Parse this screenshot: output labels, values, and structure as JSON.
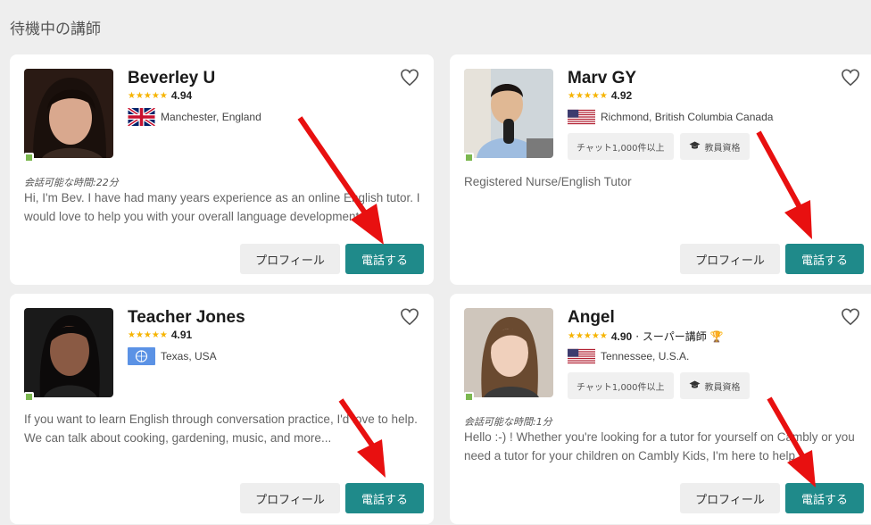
{
  "section_title": "待機中の講師",
  "profile_label": "プロフィール",
  "call_label": "電話する",
  "colors": {
    "accent": "#1f8a8a",
    "star": "#f6b400",
    "online": "#7cb850",
    "arrow": "#e81010"
  },
  "tutors": [
    {
      "name": "Beverley U",
      "stars": "★★★★★",
      "rating": "4.94",
      "location": "Manchester, England",
      "flag": "uk-flag-icon",
      "availability": "会話可能な時間:22分",
      "description": "Hi, I'm Bev. I have had many years experience as an online English tutor. I would love to help you with your overall language development."
    },
    {
      "name": "Marv GY",
      "stars": "★★★★★",
      "rating": "4.92",
      "location": "Richmond, British Columbia Canada",
      "flag": "us-flag-icon",
      "badge_chat": "チャット1,000件以上",
      "badge_teacher": "教員資格",
      "description": "Registered Nurse/English Tutor"
    },
    {
      "name": "Teacher Jones",
      "stars": "★★★★★",
      "rating": "4.91",
      "location": "Texas, USA",
      "flag": "un-flag-icon",
      "description": "If you want to learn English through conversation practice, I'd love to help. We can talk about cooking, gardening, music, and more..."
    },
    {
      "name": "Angel",
      "stars": "★★★★★",
      "rating": "4.90",
      "rating_extra": "· スーパー講師 🏆",
      "location": "Tennessee, U.S.A.",
      "flag": "us-flag-icon",
      "badge_chat": "チャット1,000件以上",
      "badge_teacher": "教員資格",
      "availability": "会話可能な時間:1分",
      "description": "Hello :-) ! Whether you're looking for a tutor for yourself on Cambly or you need a tutor for your children on Cambly Kids, I'm here to help."
    }
  ]
}
